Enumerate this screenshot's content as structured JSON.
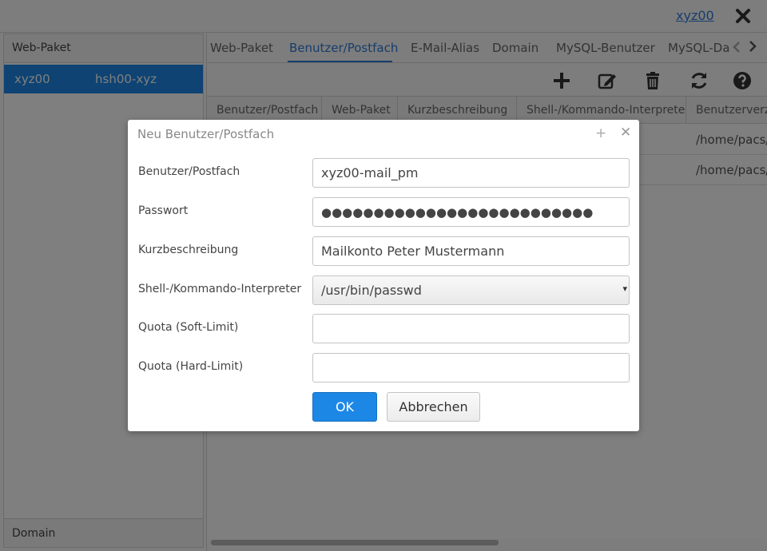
{
  "topbar": {
    "user": "xyz00",
    "logout_icon": "close-icon"
  },
  "left_panel": {
    "header": "Web-Paket",
    "rows": [
      {
        "name": "xyz00",
        "package": "hsh00-xyz"
      }
    ],
    "footer": "Domain"
  },
  "tabs": {
    "items": [
      "Web-Paket",
      "Benutzer/Postfach",
      "E-Mail-Alias",
      "Domain",
      "MySQL-Benutzer",
      "MySQL-Da"
    ],
    "active": "Benutzer/Postfach",
    "scroll_left_icon": "chevron-left-icon",
    "scroll_right_icon": "chevron-right-icon"
  },
  "toolbar": {
    "icons": [
      "plus-icon",
      "edit-icon",
      "trash-icon",
      "refresh-icon",
      "help-icon"
    ]
  },
  "table": {
    "columns": [
      "Benutzer/Postfach",
      "Web-Paket",
      "Kurzbeschreibung",
      "Shell-/Kommando-Interpreter",
      "Benutzerverze"
    ],
    "rows": [
      {
        "home": "/home/pacs/"
      },
      {
        "home": "/home/pacs/"
      }
    ]
  },
  "dialog": {
    "title": "Neu Benutzer/Postfach",
    "fields": {
      "user": {
        "label": "Benutzer/Postfach",
        "value": "xyz00-mail_pm"
      },
      "password": {
        "label": "Passwort",
        "value": "●●●●●●●●●●●●●●●●●●●●●●●●●●"
      },
      "description": {
        "label": "Kurzbeschreibung",
        "value": "Mailkonto Peter Mustermann"
      },
      "shell": {
        "label": "Shell-/Kommando-Interpreter",
        "value": "/usr/bin/passwd"
      },
      "quota_soft": {
        "label": "Quota (Soft-Limit)",
        "value": ""
      },
      "quota_hard": {
        "label": "Quota (Hard-Limit)",
        "value": ""
      }
    },
    "ok_label": "OK",
    "cancel_label": "Abbrechen"
  }
}
